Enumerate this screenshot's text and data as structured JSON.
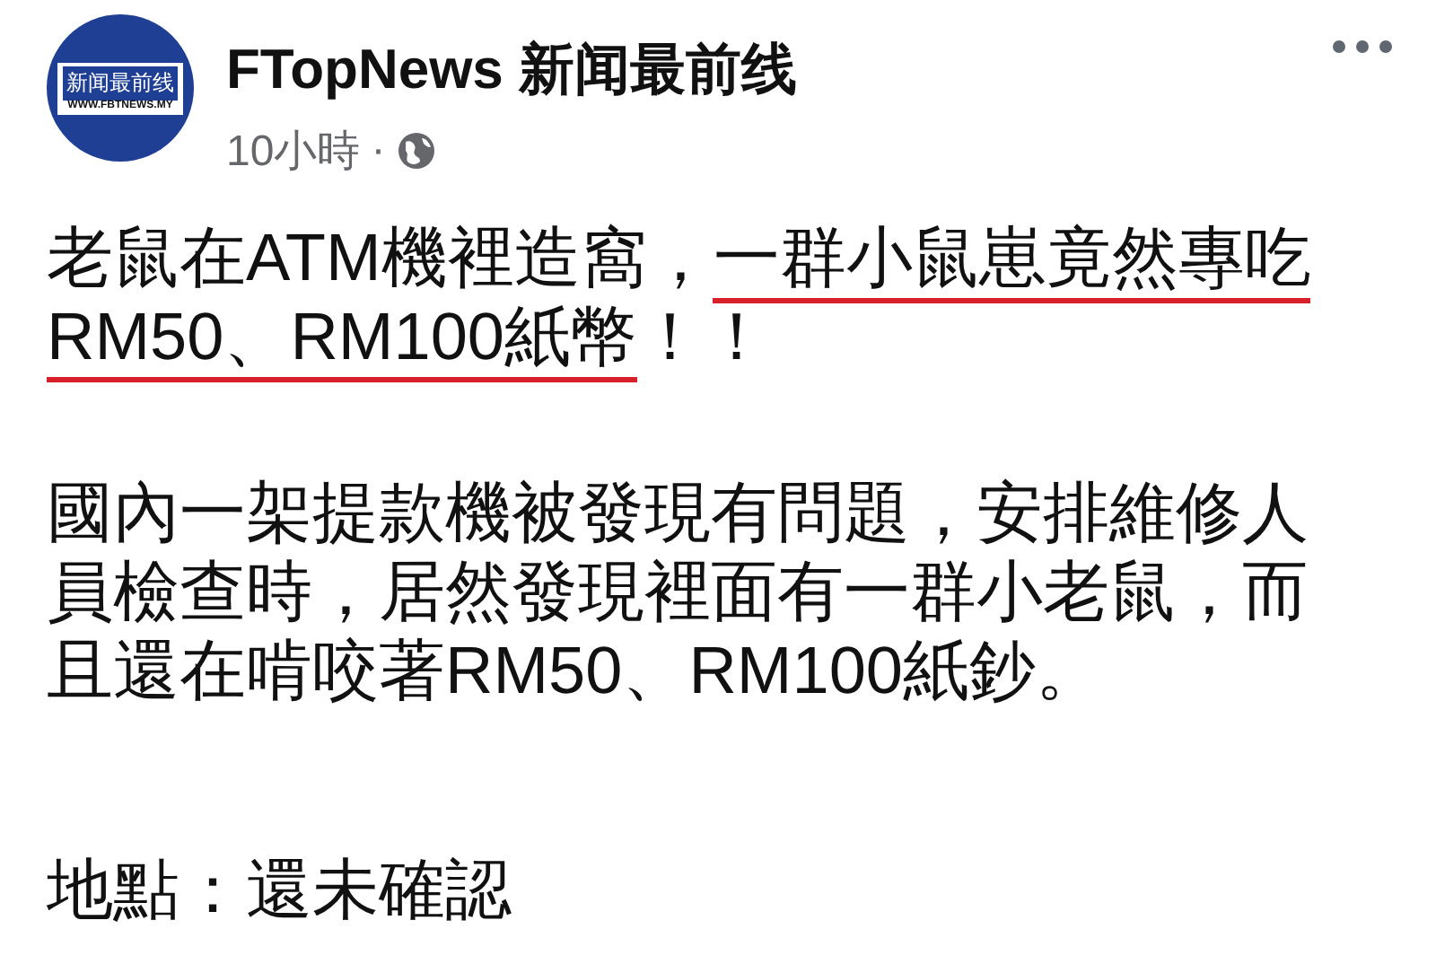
{
  "logo": {
    "title": "新闻最前线",
    "url": "WWW.FBTNEWS.MY"
  },
  "page_name": "FTopNews 新闻最前线",
  "time": "10小時",
  "separator": "·",
  "paragraphs": [
    {
      "segments": [
        {
          "text": "老鼠在ATM機裡造窩，",
          "underlined": false
        },
        {
          "text": "一群小鼠崽竟然專吃RM50、RM100紙幣",
          "underlined": true
        },
        {
          "text": "！！",
          "underlined": false
        }
      ]
    },
    {
      "segments": [
        {
          "text": "國內一架提款機被發現有問題，安排維修人員檢查時，居然發現裡面有一群小老鼠，而且還在啃咬著RM50、RM100紙鈔。",
          "underlined": false
        }
      ]
    },
    {
      "segments": [
        {
          "text": "地點：還未確認",
          "underlined": false
        }
      ]
    }
  ]
}
